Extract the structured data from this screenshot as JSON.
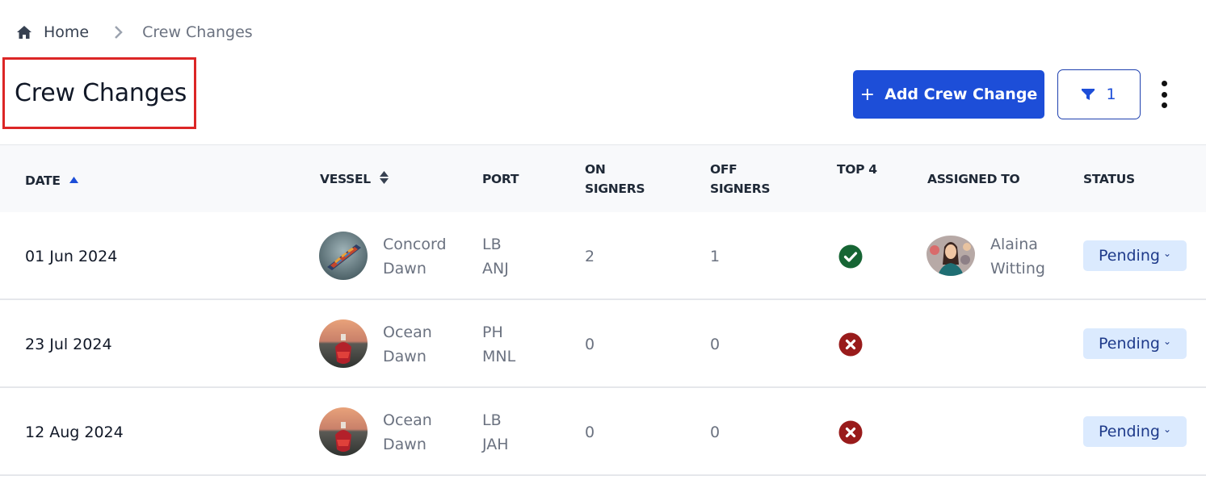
{
  "breadcrumb": {
    "home_label": "Home",
    "current_label": "Crew Changes"
  },
  "header": {
    "title": "Crew Changes",
    "add_button_label": "Add Crew Change",
    "add_button_icon": "plus-icon",
    "filter_count": "1",
    "filter_icon": "funnel-icon",
    "more_icon": "kebab-menu-icon"
  },
  "colors": {
    "primary": "#1d4ed8",
    "highlight_border": "#dc2626",
    "success": "#166534",
    "danger": "#991b1b",
    "pill_bg": "#dbeafe",
    "pill_text": "#1e3a8a"
  },
  "table": {
    "columns": [
      {
        "key": "date",
        "label": "DATE",
        "sort": "ascending"
      },
      {
        "key": "vessel",
        "label": "VESSEL",
        "sort": "sortable"
      },
      {
        "key": "port",
        "label": "PORT"
      },
      {
        "key": "on_signers",
        "label": "ON SIGNERS"
      },
      {
        "key": "off_signers",
        "label": "OFF SIGNERS"
      },
      {
        "key": "top4",
        "label": "TOP 4"
      },
      {
        "key": "assigned_to",
        "label": "ASSIGNED TO"
      },
      {
        "key": "status",
        "label": "STATUS"
      }
    ],
    "rows": [
      {
        "date": "01 Jun 2024",
        "vessel_line1": "Concord",
        "vessel_line2": "Dawn",
        "port_line1": "LB",
        "port_line2": "ANJ",
        "on_signers": "2",
        "off_signers": "1",
        "top4": "check",
        "assigned_line1": "Alaina",
        "assigned_line2": "Witting",
        "status": "Pending"
      },
      {
        "date": "23 Jul 2024",
        "vessel_line1": "Ocean",
        "vessel_line2": "Dawn",
        "port_line1": "PH",
        "port_line2": "MNL",
        "on_signers": "0",
        "off_signers": "0",
        "top4": "cross",
        "assigned_line1": "",
        "assigned_line2": "",
        "status": "Pending"
      },
      {
        "date": "12 Aug 2024",
        "vessel_line1": "Ocean",
        "vessel_line2": "Dawn",
        "port_line1": "LB",
        "port_line2": "JAH",
        "on_signers": "0",
        "off_signers": "0",
        "top4": "cross",
        "assigned_line1": "",
        "assigned_line2": "",
        "status": "Pending"
      }
    ]
  }
}
